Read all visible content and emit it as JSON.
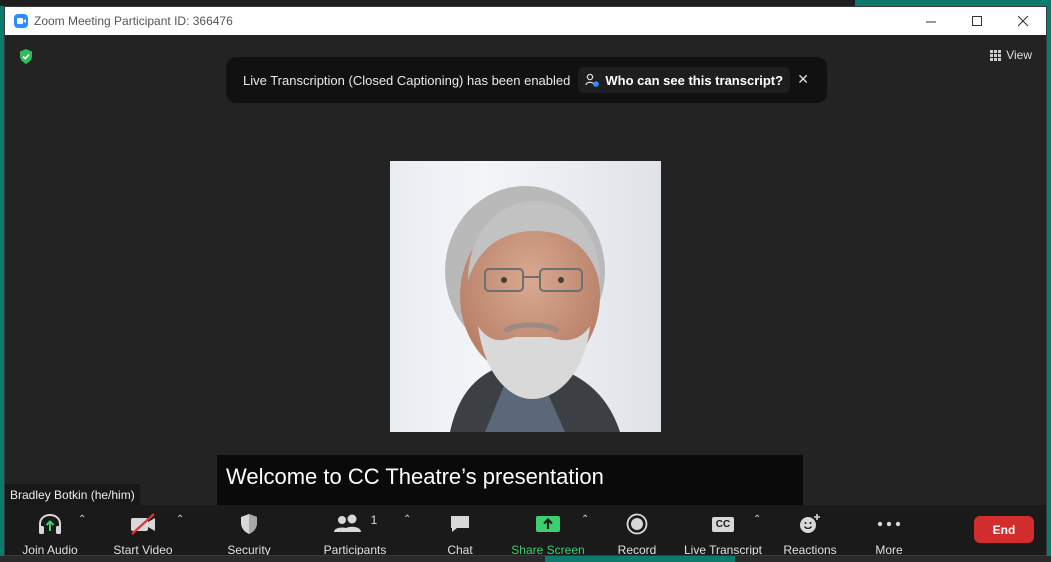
{
  "window": {
    "title": "Zoom Meeting Participant ID: 366476"
  },
  "view": {
    "label": "View"
  },
  "banner": {
    "message": "Live Transcription (Closed Captioning) has been enabled",
    "link_label": "Who can see this transcript?",
    "close_glyph": "✕"
  },
  "caption": {
    "text": "Welcome to CC Theatre’s presentation"
  },
  "participant": {
    "name": "Bradley Botkin (he/him)"
  },
  "toolbar": {
    "join_audio": "Join Audio",
    "start_video": "Start Video",
    "security": "Security",
    "participants": "Participants",
    "participants_count": "1",
    "chat": "Chat",
    "share_screen": "Share Screen",
    "record": "Record",
    "live_transcript": "Live Transcript",
    "cc_badge": "CC",
    "reactions": "Reactions",
    "more": "More",
    "end": "End"
  },
  "colors": {
    "accent_green": "#3cd070",
    "end_red": "#d12d2d",
    "brand_blue": "#2d8cff"
  }
}
